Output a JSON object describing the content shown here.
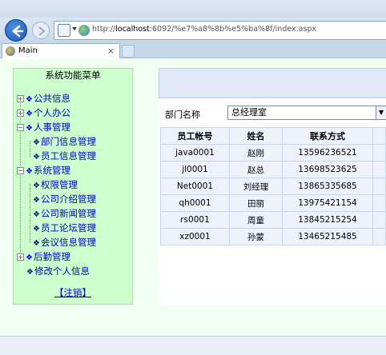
{
  "browser": {
    "address_prefix": "http://",
    "address_host": "localhost",
    "address_rest": ":6092/%e7%a8%8b%e5%ba%8f/index.aspx",
    "tab_title": "Main",
    "tab_close": "×"
  },
  "sidebar": {
    "title": "系统功能菜单",
    "items": [
      {
        "label": "公共信息",
        "level": 0,
        "expanded": false
      },
      {
        "label": "个人办公",
        "level": 0,
        "expanded": false
      },
      {
        "label": "人事管理",
        "level": 0,
        "expanded": true
      },
      {
        "label": "部门信息管理",
        "level": 1
      },
      {
        "label": "员工信息管理",
        "level": 1
      },
      {
        "label": "系统管理",
        "level": 0,
        "expanded": true
      },
      {
        "label": "权限管理",
        "level": 1
      },
      {
        "label": "公司介绍管理",
        "level": 1
      },
      {
        "label": "公司新闻管理",
        "level": 1
      },
      {
        "label": "员工论坛管理",
        "level": 1
      },
      {
        "label": "会议信息管理",
        "level": 1
      },
      {
        "label": "后勤管理",
        "level": 0,
        "expanded": false
      },
      {
        "label": "修改个人信息",
        "level": 0
      }
    ],
    "logout_label": "【注销】"
  },
  "filter": {
    "label": "部门名称",
    "selected": "总经理室"
  },
  "table": {
    "headers": [
      "员工帐号",
      "姓名",
      "联系方式",
      ""
    ],
    "rows": [
      [
        "java0001",
        "赵刚",
        "13596236521",
        ""
      ],
      [
        "jl0001",
        "赵总",
        "13698523625",
        ""
      ],
      [
        "Net0001",
        "刘经理",
        "13865335685",
        ""
      ],
      [
        "qh0001",
        "田丽",
        "13975421154",
        ""
      ],
      [
        "rs0001",
        "周童",
        "13845215254",
        ""
      ],
      [
        "xz0001",
        "孙蒙",
        "13465215485",
        ""
      ]
    ]
  },
  "colors": {
    "sidebar_bg": "#ccffcc",
    "page_bg": "#f0fff0",
    "link": "#0000cc",
    "grid_cell": "#eef3fb",
    "banner": "#e0e8f8"
  }
}
